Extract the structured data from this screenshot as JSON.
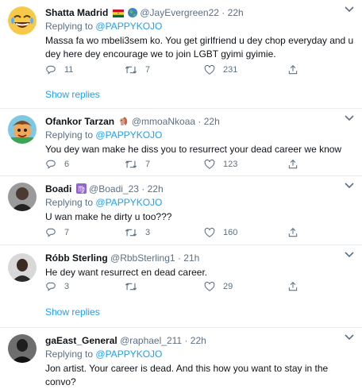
{
  "tweets": [
    {
      "name": "Shatta Madrid",
      "emoji": "ghana-flag-globe",
      "handle": "@JayEvergreen22",
      "time": "22h",
      "replying_label": "Replying to",
      "replying_to": "@PAPPYKOJO",
      "text": "Massa fa wo mbeli3sem ko. You get girlfriend u dey chop everyday and u dey here dey encourage we to join LGBT gyimi gyimie.",
      "replies": "11",
      "retweets": "7",
      "likes": "231",
      "show_replies": "Show replies"
    },
    {
      "name": "Ofankor Tarzan",
      "emoji": "squirrel",
      "handle": "@mmoaNkoaa",
      "time": "22h",
      "replying_label": "Replying to",
      "replying_to": "@PAPPYKOJO",
      "text": "You dey wan make he diss you to resurrect your dead career we know",
      "replies": "6",
      "retweets": "7",
      "likes": "123"
    },
    {
      "name": "Boadi",
      "emoji": "virgo-sign",
      "handle": "@Boadi_23",
      "time": "22h",
      "replying_label": "Replying to",
      "replying_to": "@PAPPYKOJO",
      "text": "U wan make he dirty u too???",
      "replies": "7",
      "retweets": "3",
      "likes": "160"
    },
    {
      "name": "Róbb Sterling",
      "handle": "@RbbSterling1",
      "time": "21h",
      "text": "He dey want resurrect en dead career.",
      "replies": "3",
      "retweets": "",
      "likes": "29",
      "show_replies": "Show replies"
    },
    {
      "name": "gaEast_General",
      "handle": "@raphael_211",
      "time": "22h",
      "replying_label": "Replying to",
      "replying_to": "@PAPPYKOJO",
      "text": "Jon artist. Your career is dead. And this how you want to stay in the convo?"
    }
  ],
  "separator": "·",
  "colors": {
    "accent": "#1da1f2",
    "muted": "#5b7083",
    "border": "#e6ecf0"
  },
  "icons": [
    "reply-icon",
    "retweet-icon",
    "like-icon",
    "share-icon",
    "more-caret-icon"
  ]
}
